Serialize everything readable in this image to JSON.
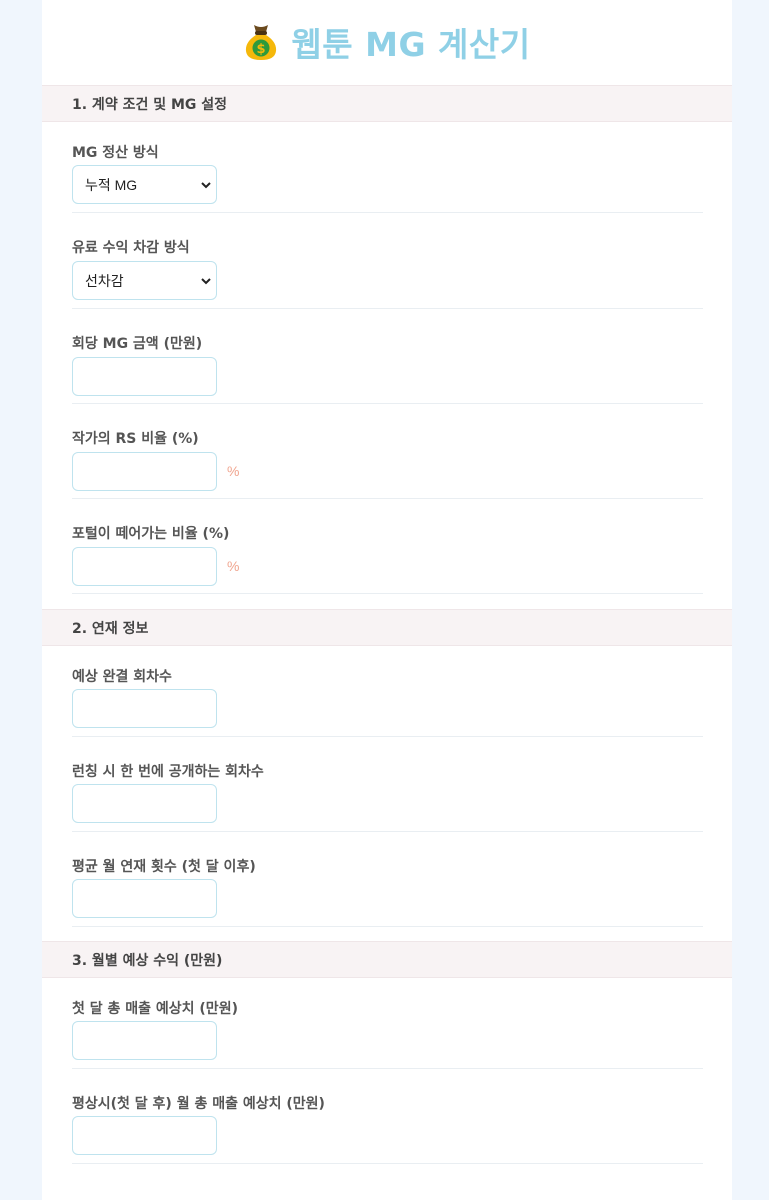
{
  "app": {
    "title": "웹툰 MG 계산기",
    "title_icon": "money-bag-icon",
    "title_color": "#8fd0e6"
  },
  "sections": [
    {
      "label": "1. 계약 조건 및 MG 설정"
    },
    {
      "label": "2. 연재 정보"
    },
    {
      "label": "3. 월별 예상 수익 (만원)"
    }
  ],
  "fields": {
    "mg_method": {
      "label": "MG 정산 방식",
      "value": "누적 MG"
    },
    "paid_deduction": {
      "label": "유료 수익 차감 방식",
      "value": "선차감"
    },
    "mg_per_episode": {
      "label": "회당 MG 금액 (만원)",
      "value": ""
    },
    "author_rs": {
      "label": "작가의 RS 비율 (%)",
      "value": "",
      "unit": "%"
    },
    "portal_rate": {
      "label": "포털이 떼어가는 비율 (%)",
      "value": "",
      "unit": "%"
    },
    "total_episodes": {
      "label": "예상 완결 회차수",
      "value": ""
    },
    "launch_episodes": {
      "label": "런칭 시 한 번에 공개하는 회차수",
      "value": ""
    },
    "monthly_episodes": {
      "label": "평균 월 연재 횟수 (첫 달 이후)",
      "value": ""
    },
    "first_month_sales": {
      "label": "첫 달 총 매출 예상치 (만원)",
      "value": ""
    },
    "monthly_sales": {
      "label": "평상시(첫 달 후) 월 총 매출 예상치 (만원)",
      "value": ""
    }
  },
  "colors": {
    "page_bg": "#f0f6fd",
    "section_bg": "#f8f3f4",
    "input_border": "#bfe3ee",
    "unit": "#f0a58f"
  }
}
